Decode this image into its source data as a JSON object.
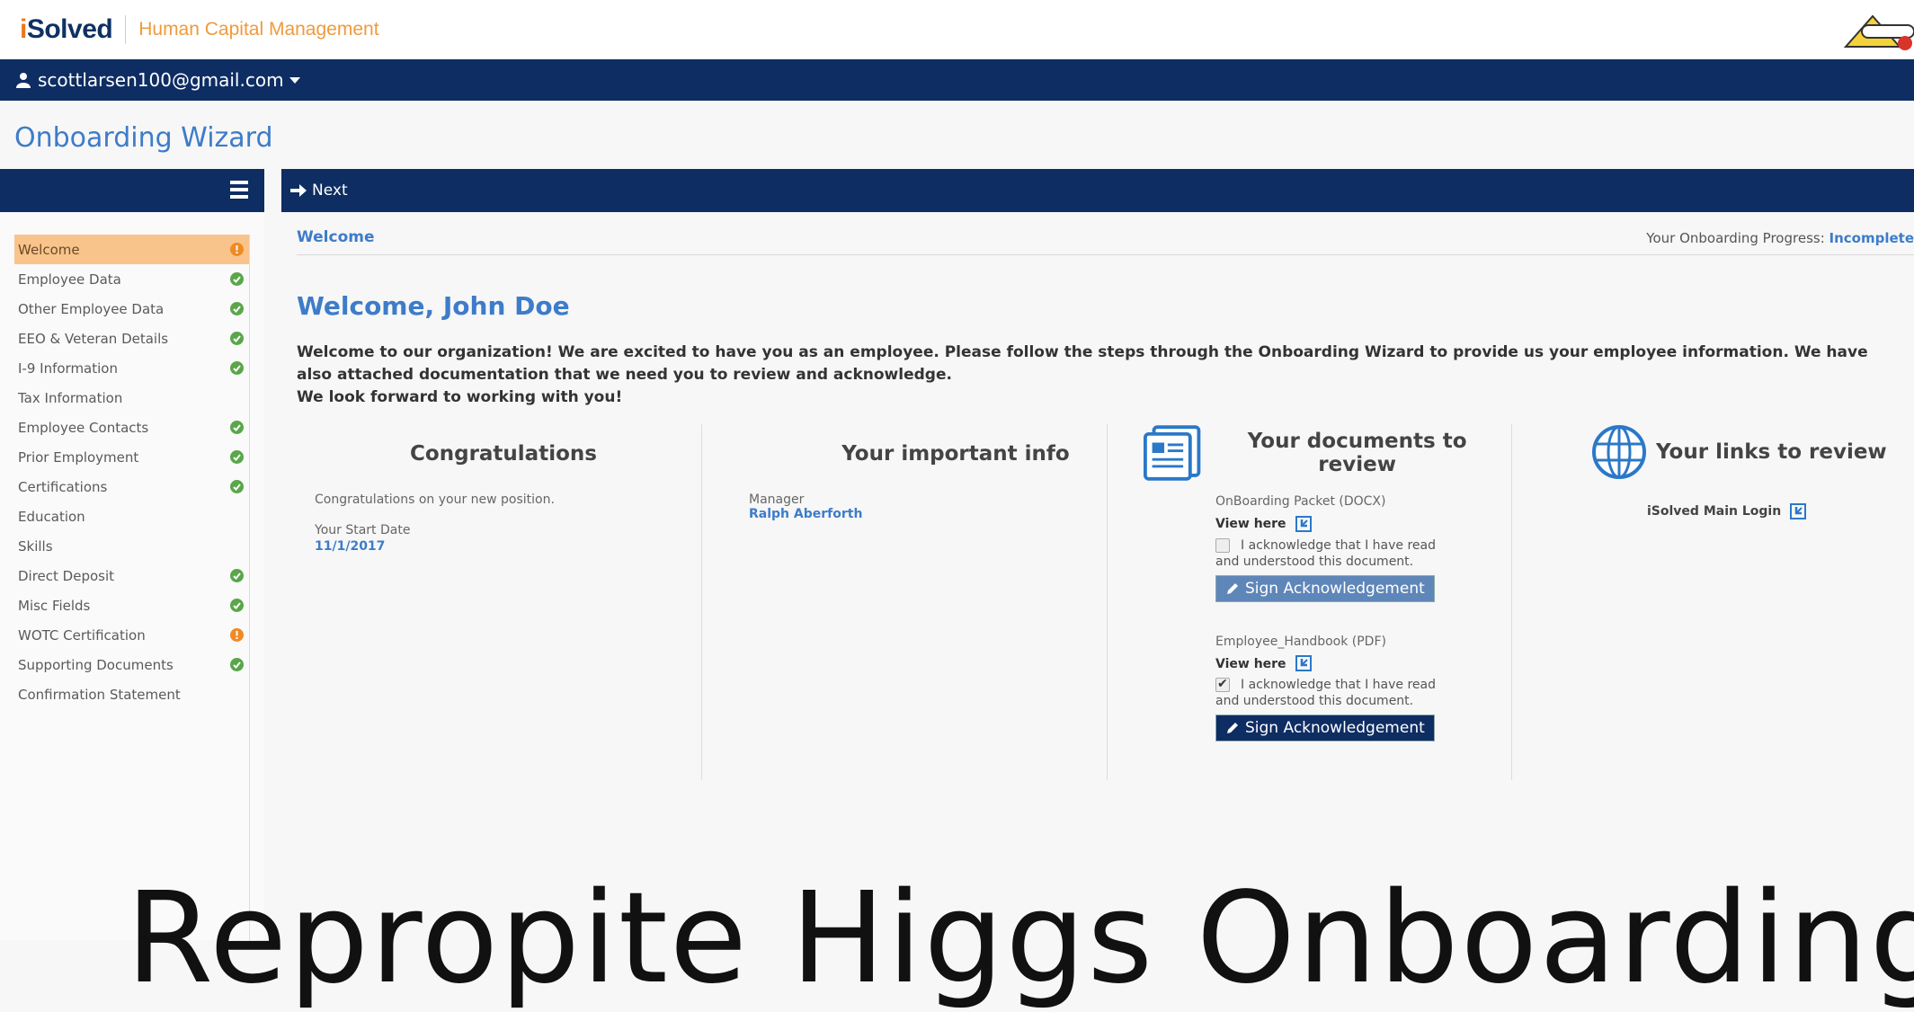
{
  "brand": {
    "logo_prefix": "i",
    "logo_rest": "Solved",
    "subtitle": "Human Capital Management"
  },
  "user": {
    "email": "scottlarsen100@gmail.com"
  },
  "page_title": "Onboarding Wizard",
  "toolbar": {
    "next_label": "Next"
  },
  "sidebar": {
    "items": [
      {
        "label": "Welcome",
        "status": "warn"
      },
      {
        "label": "Employee Data",
        "status": "ok"
      },
      {
        "label": "Other Employee Data",
        "status": "ok"
      },
      {
        "label": "EEO & Veteran Details",
        "status": "ok"
      },
      {
        "label": "I-9 Information",
        "status": "ok"
      },
      {
        "label": "Tax Information",
        "status": ""
      },
      {
        "label": "Employee Contacts",
        "status": "ok"
      },
      {
        "label": "Prior Employment",
        "status": "ok"
      },
      {
        "label": "Certifications",
        "status": "ok"
      },
      {
        "label": "Education",
        "status": ""
      },
      {
        "label": "Skills",
        "status": ""
      },
      {
        "label": "Direct Deposit",
        "status": "ok"
      },
      {
        "label": "Misc Fields",
        "status": "ok"
      },
      {
        "label": "WOTC Certification",
        "status": "warn"
      },
      {
        "label": "Supporting Documents",
        "status": "ok"
      },
      {
        "label": "Confirmation Statement",
        "status": ""
      }
    ]
  },
  "section": {
    "title": "Welcome",
    "progress_label": "Your Onboarding Progress: ",
    "progress_value": "Incomplete"
  },
  "welcome": {
    "title": "Welcome, John Doe",
    "intro_line1": "Welcome to our organization! We are excited to have you as an employee. Please follow the steps through the Onboarding Wizard to provide us your employee information. We have also attached documentation that we need you to review and acknowledge.",
    "intro_line2": "We look forward to working with you!"
  },
  "congrats": {
    "title": "Congratulations",
    "message": "Congratulations on your new position.",
    "start_label": "Your Start Date",
    "start_date": "11/1/2017"
  },
  "info": {
    "title": "Your important info",
    "manager_label": "Manager",
    "manager_name": "Ralph Aberforth"
  },
  "documents": {
    "title": "Your documents to review",
    "items": [
      {
        "name": "OnBoarding Packet (DOCX)",
        "view_label": "View here",
        "ack_line1": "I acknowledge that I have read",
        "ack_line2": "and understood this document.",
        "checked": false,
        "sign_label": "Sign Acknowledgement"
      },
      {
        "name": "Employee_Handbook (PDF)",
        "view_label": "View here",
        "ack_line1": "I acknowledge that I have read",
        "ack_line2": "and understood this document.",
        "checked": true,
        "sign_label": "Sign Acknowledgement"
      }
    ]
  },
  "links": {
    "title": "Your links to review",
    "items": [
      {
        "label": "iSolved Main Login"
      }
    ]
  },
  "overlay": {
    "text": "Repropite Higgs Onboarding"
  },
  "colors": {
    "navy": "#0e2d63",
    "accent_blue": "#3d7cc9",
    "active_orange": "#f9c48b",
    "ok_green": "#5aa64a",
    "warn_orange": "#f08a24"
  }
}
